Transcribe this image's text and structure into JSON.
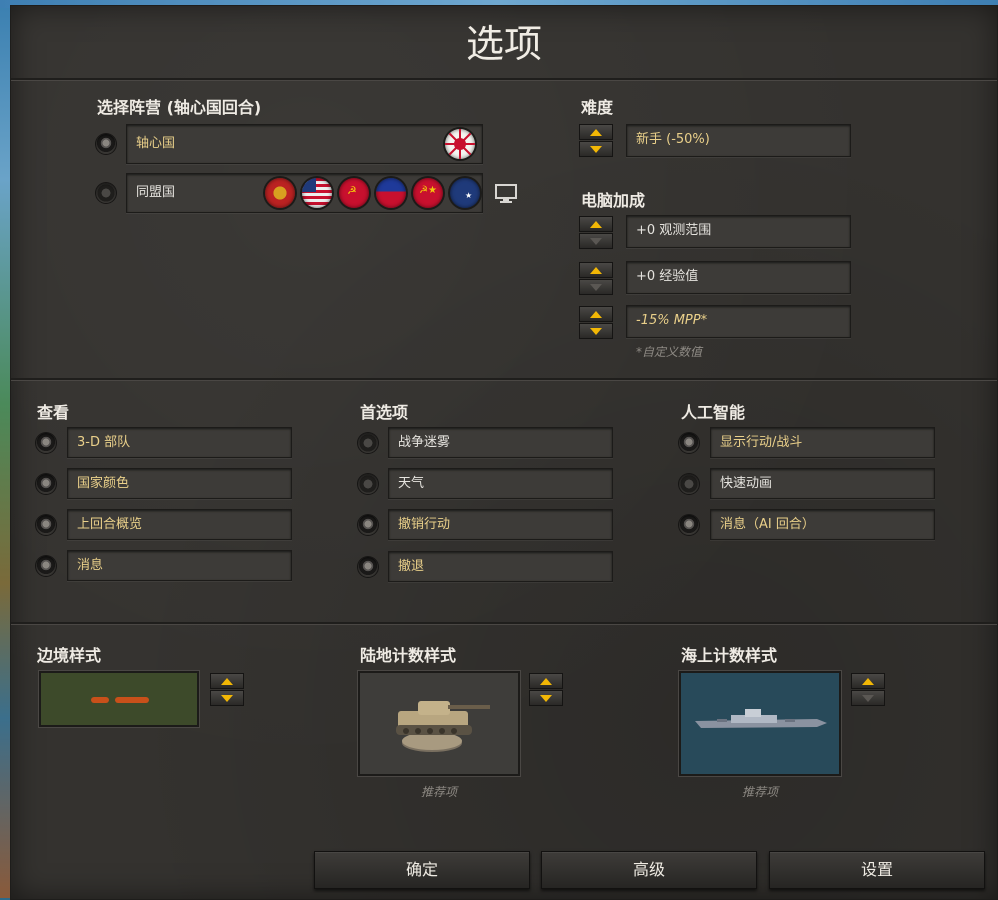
{
  "title": "选项",
  "faction": {
    "heading": "选择阵营 (轴心国回合)",
    "options": [
      {
        "label": "轴心国",
        "selected": true
      },
      {
        "label": "同盟国",
        "selected": false
      }
    ]
  },
  "difficulty": {
    "heading": "难度",
    "value": "新手 (-50%)"
  },
  "ai_bonus": {
    "heading": "电脑加成",
    "items": [
      "+0 观测范围",
      "+0 经验值",
      "-15% MPP*"
    ],
    "note": "*自定义数值"
  },
  "view": {
    "heading": "查看",
    "items": [
      {
        "label": "3-D 部队",
        "on": true
      },
      {
        "label": "国家颜色",
        "on": true
      },
      {
        "label": "上回合概览",
        "on": true
      },
      {
        "label": "消息",
        "on": true
      }
    ]
  },
  "prefs": {
    "heading": "首选项",
    "items": [
      {
        "label": "战争迷雾",
        "on": false
      },
      {
        "label": "天气",
        "on": false
      },
      {
        "label": "撤销行动",
        "on": true
      },
      {
        "label": "撤退",
        "on": true
      }
    ]
  },
  "ai": {
    "heading": "人工智能",
    "items": [
      {
        "label": "显示行动/战斗",
        "on": true
      },
      {
        "label": "快速动画",
        "on": false
      },
      {
        "label": "消息（AI 回合）",
        "on": true
      }
    ]
  },
  "border_style": {
    "heading": "边境样式"
  },
  "land_style": {
    "heading": "陆地计数样式",
    "caption": "推荐项"
  },
  "sea_style": {
    "heading": "海上计数样式",
    "caption": "推荐项"
  },
  "buttons": {
    "ok": "确定",
    "advanced": "高级",
    "settings": "设置"
  },
  "colors": {
    "accent": "#f2b705",
    "gold_text": "#ead08a",
    "panel": "#34322f"
  }
}
